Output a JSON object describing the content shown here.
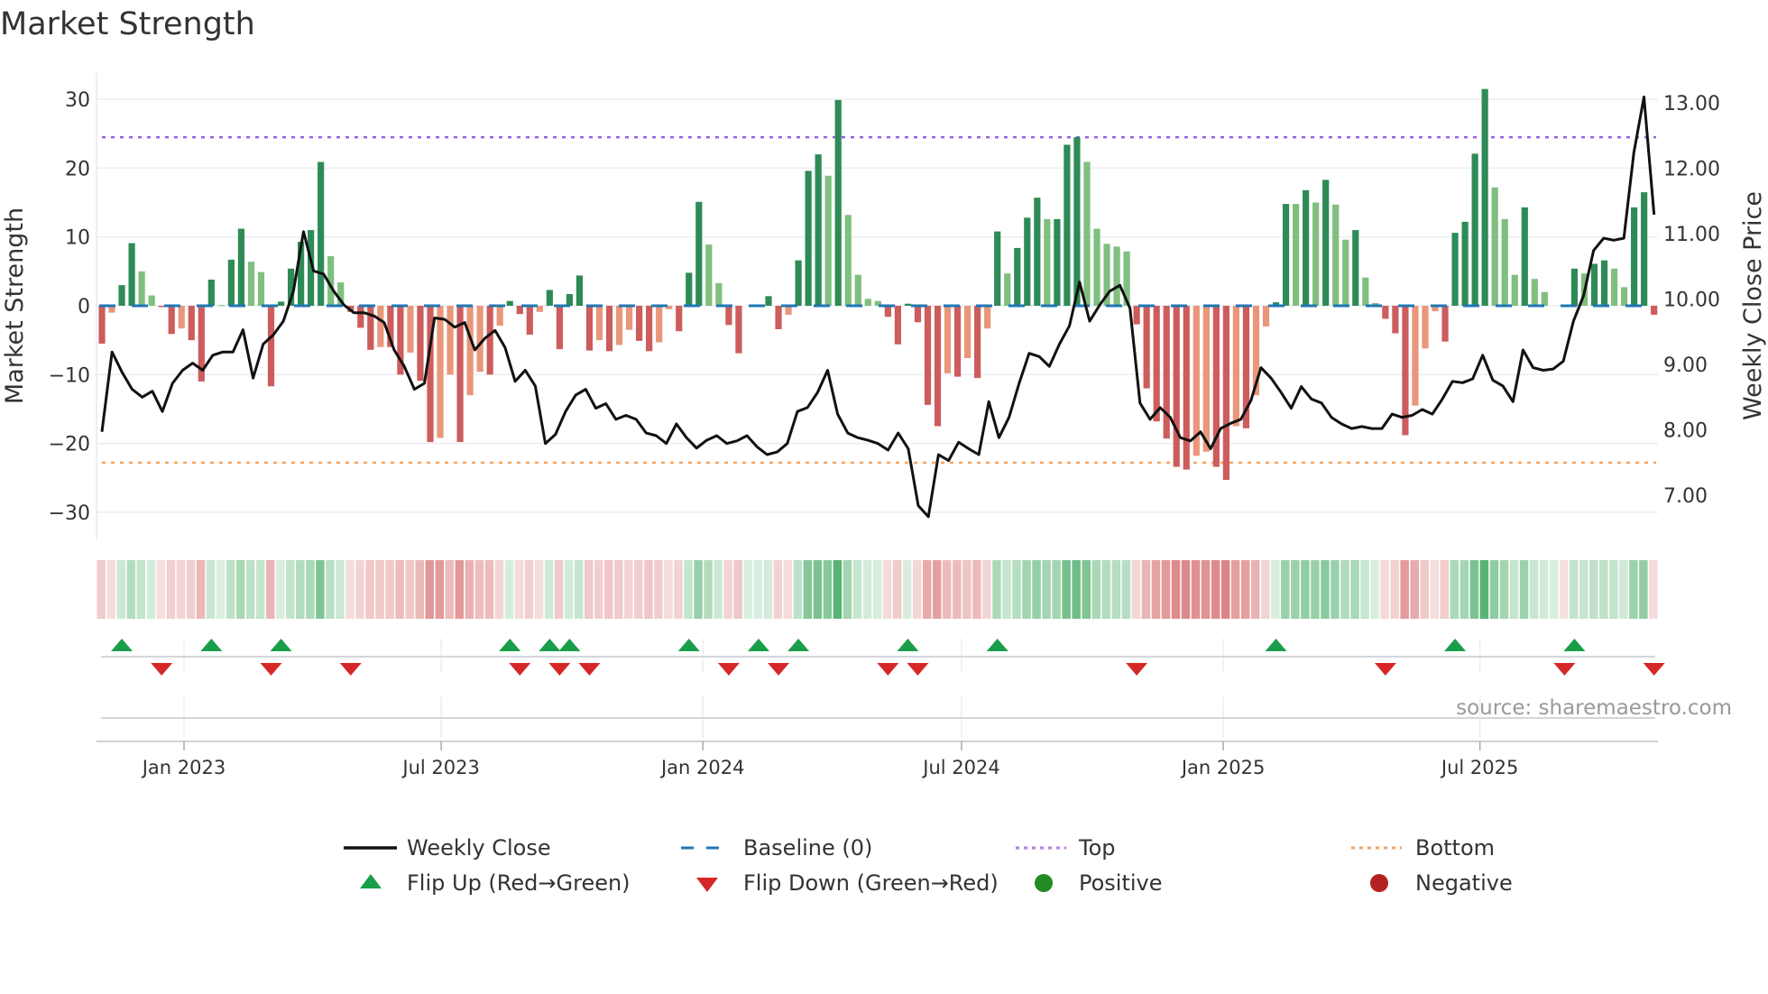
{
  "title": "Market Strength",
  "y_axis_title": "Market Strength",
  "y2_axis_title": "Weekly Close Price",
  "source": "source: sharemaestro.com",
  "legend": {
    "weekly_close": "Weekly Close",
    "baseline": "Baseline (0)",
    "top": "Top",
    "bottom": "Bottom",
    "flip_up": "Flip Up (Red→Green)",
    "flip_down": "Flip Down (Green→Red)",
    "positive": "Positive",
    "negative": "Negative"
  },
  "colors": {
    "strong_green": "#2e8b57",
    "weak_green": "#7fbf7f",
    "strong_red": "#cd5c5c",
    "weak_red": "#e9967a",
    "baseline": "#1f77b4",
    "top": "#9a5fe0",
    "bottom": "#f4a460",
    "flip_up": "#1a9e4a",
    "flip_down": "#d62728",
    "positive": "#228b22",
    "negative": "#b22222",
    "price": "#111111"
  },
  "chart_data": {
    "type": "bar+line",
    "title": "Market Strength",
    "ylabel": "Market Strength",
    "y2label": "Weekly Close Price",
    "ylim": [
      -30,
      30
    ],
    "y2lim": [
      7,
      13
    ],
    "y_ticks": [
      "30",
      "20",
      "10",
      "0",
      "−10",
      "−20",
      "−30"
    ],
    "y_tick_values": [
      30,
      20,
      10,
      0,
      -10,
      -20,
      -30
    ],
    "y2_ticks": [
      "13.00",
      "12.00",
      "11.00",
      "10.00",
      "9.00",
      "8.00",
      "7.00"
    ],
    "y2_tick_values": [
      13,
      12,
      11,
      10,
      9,
      8,
      7
    ],
    "x_ticks": [
      {
        "label": "Jan 2023",
        "week": 8.25
      },
      {
        "label": "Jul 2023",
        "week": 34.1
      },
      {
        "label": "Jan 2024",
        "week": 60.4
      },
      {
        "label": "Jul 2024",
        "week": 86.4
      },
      {
        "label": "Jan 2025",
        "week": 112.7
      },
      {
        "label": "Jul 2025",
        "week": 138.5
      }
    ],
    "top": 24.5,
    "bottom": -22.8,
    "baseline": 0,
    "strength": [
      -5.5,
      -1,
      3,
      9.1,
      5,
      1.5,
      -0.2,
      -4.1,
      -3.3,
      -5,
      -11,
      3.8,
      0.1,
      6.7,
      11.2,
      6.4,
      4.9,
      -11.7,
      0.6,
      5.4,
      9.3,
      11,
      20.9,
      7.2,
      3.4,
      -0.9,
      -3.2,
      -6.4,
      -6,
      -6,
      -10,
      -6.8,
      -10.9,
      -19.8,
      -19.2,
      -10,
      -19.8,
      -13,
      -9.6,
      -10,
      -2.9,
      0.7,
      -1.2,
      -4.2,
      -0.9,
      2.3,
      -6.3,
      1.7,
      4.4,
      -6.5,
      -5,
      -6.6,
      -5.7,
      -3.5,
      -5.1,
      -6.6,
      -5.3,
      -0.5,
      -3.7,
      4.8,
      15.1,
      8.9,
      3.3,
      -2.8,
      -6.9,
      0,
      0.2,
      1.4,
      -3.4,
      -1.3,
      6.6,
      19.6,
      22,
      18.9,
      29.9,
      13.2,
      4.5,
      1,
      0.7,
      -1.6,
      -5.6,
      0.3,
      -2.4,
      -14.4,
      -17.5,
      -9.8,
      -10.3,
      -7.6,
      -10.5,
      -3.3,
      10.8,
      4.7,
      8.4,
      12.8,
      15.7,
      12.6,
      12.6,
      23.4,
      24.5,
      20.9,
      11.2,
      9,
      8.6,
      7.9,
      -2.7,
      -12,
      -16.8,
      -19.3,
      -23.4,
      -23.8,
      -21.8,
      -21.2,
      -23.4,
      -25.3,
      -17.5,
      -17.8,
      -13,
      -3,
      0.5,
      14.8,
      14.8,
      16.8,
      15,
      18.3,
      14.7,
      9.6,
      11,
      4.1,
      0.4,
      -1.9,
      -4,
      -18.8,
      -14.5,
      -6.2,
      -0.8,
      -5.2,
      10.6,
      12.2,
      22.1,
      31.5,
      17.2,
      12.6,
      4.5,
      14.3,
      3.9,
      2,
      0,
      -0.2,
      5.4,
      4.7,
      6.1,
      6.6,
      5.4,
      2.7,
      14.3,
      16.5,
      -1.3
    ],
    "strength_shade": "DLDDLLDDLDDDLDDLLDDDDDDLLDDDLDDLDDLLDLLDLDDDLDDDDDLDLLDDLLDDDLLDDDDDDLDDDLDLLLLDDDDDDLDLDLDLDDDLDDDLLLLLDDDDDDLLDDLDLLDDLDLDLLDLLDDDLLLDDDDDLLLDLLDDDLDDLLDDD",
    "weekly_close": [
      7.97,
      9.19,
      8.88,
      8.62,
      8.5,
      8.59,
      8.28,
      8.71,
      8.91,
      9.02,
      8.91,
      9.14,
      9.19,
      9.19,
      9.53,
      8.79,
      9.31,
      9.45,
      9.66,
      10.12,
      11.03,
      10.43,
      10.38,
      10.12,
      9.91,
      9.79,
      9.79,
      9.74,
      9.64,
      9.22,
      8.97,
      8.62,
      8.71,
      9.71,
      9.69,
      9.57,
      9.64,
      9.22,
      9.4,
      9.52,
      9.26,
      8.74,
      8.91,
      8.67,
      7.79,
      7.93,
      8.28,
      8.53,
      8.62,
      8.33,
      8.4,
      8.16,
      8.22,
      8.16,
      7.95,
      7.91,
      7.79,
      8.09,
      7.88,
      7.72,
      7.84,
      7.91,
      7.79,
      7.83,
      7.91,
      7.74,
      7.62,
      7.66,
      7.79,
      8.28,
      8.34,
      8.57,
      8.91,
      8.24,
      7.95,
      7.88,
      7.84,
      7.79,
      7.69,
      7.95,
      7.71,
      6.84,
      6.67,
      7.62,
      7.53,
      7.81,
      7.71,
      7.62,
      8.43,
      7.88,
      8.19,
      8.71,
      9.17,
      9.12,
      8.97,
      9.31,
      9.59,
      10.26,
      9.66,
      9.91,
      10.12,
      10.21,
      9.86,
      8.41,
      8.16,
      8.34,
      8.19,
      7.88,
      7.83,
      7.97,
      7.71,
      8.02,
      8.1,
      8.16,
      8.45,
      8.95,
      8.79,
      8.57,
      8.33,
      8.66,
      8.47,
      8.41,
      8.19,
      8.09,
      8.02,
      8.05,
      8.02,
      8.02,
      8.24,
      8.19,
      8.22,
      8.31,
      8.24,
      8.47,
      8.74,
      8.72,
      8.78,
      9.14,
      8.76,
      8.67,
      8.43,
      9.22,
      8.95,
      8.91,
      8.93,
      9.05,
      9.66,
      10.05,
      10.74,
      10.93,
      10.9,
      10.93,
      12.24,
      13.09,
      11.29
    ],
    "flip_up_weeks": [
      2,
      11,
      18,
      41,
      45,
      47,
      59,
      66,
      70,
      81,
      90,
      118,
      136,
      148
    ],
    "flip_down_weeks": [
      6,
      17,
      25,
      42,
      46,
      49,
      63,
      68,
      79,
      82,
      104,
      129,
      147,
      156
    ]
  }
}
